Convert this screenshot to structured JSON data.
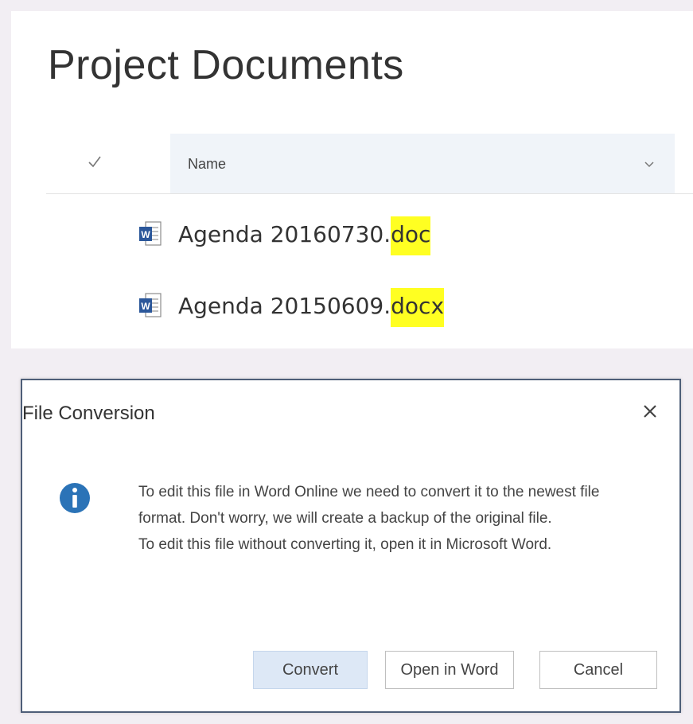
{
  "library": {
    "title": "Project Documents",
    "columns": {
      "select_icon": "checkmark-icon",
      "name_label": "Name",
      "sort_icon": "chevron-down-icon"
    },
    "files": [
      {
        "base": "Agenda 20160730.",
        "ext": "doc",
        "icon": "word-doc-icon"
      },
      {
        "base": "Agenda 20150609.",
        "ext": "docx",
        "icon": "word-doc-icon"
      }
    ],
    "highlight_color": "#ffff22"
  },
  "dialog": {
    "title": "File Conversion",
    "close_icon": "close-icon",
    "info_icon": "info-icon",
    "message_lines": [
      "To edit this file in Word Online we need to convert it to the newest file format. Don't worry, we will create a backup of the original file.",
      "To edit this file without converting it, open it in Microsoft Word."
    ],
    "buttons": {
      "convert": "Convert",
      "open_in_word": "Open in Word",
      "cancel": "Cancel"
    },
    "accent_color": "#2b73b7"
  }
}
